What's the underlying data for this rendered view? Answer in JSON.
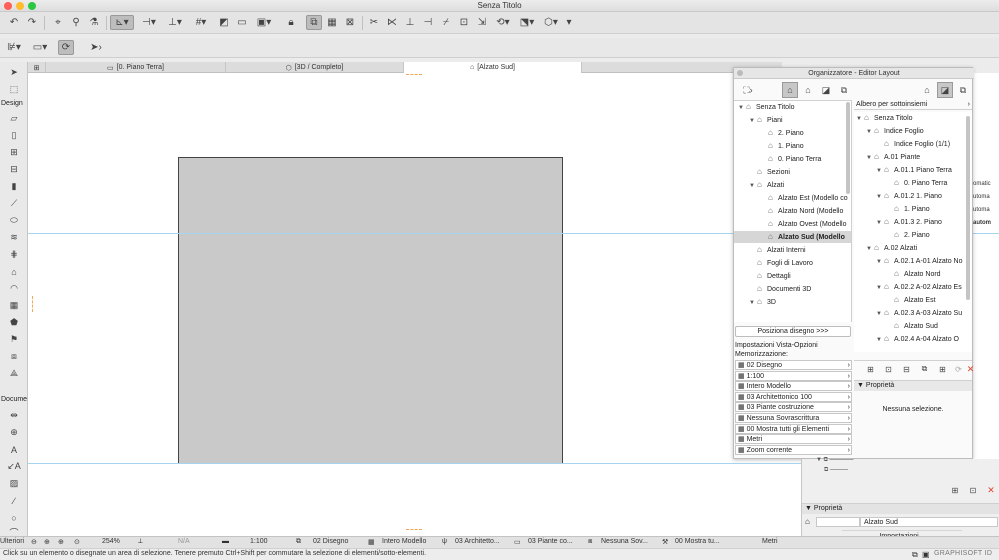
{
  "window": {
    "title": "Senza Titolo"
  },
  "toolbox": {
    "design_label": "Design",
    "document_label": "Docume",
    "more_label": "Ulteriori"
  },
  "tabs": [
    "[0. Piano Terra]",
    "[3D / Completo]",
    "[Alzato Sud]"
  ],
  "panel": {
    "title": "Organizzatore - Editor Layout",
    "left_tree": [
      {
        "label": "Senza Titolo",
        "depth": 0,
        "open": true,
        "icon": "project-icon"
      },
      {
        "label": "Piani",
        "depth": 1,
        "open": true,
        "icon": "folder-icon"
      },
      {
        "label": "2. Piano",
        "depth": 2,
        "icon": "story-icon"
      },
      {
        "label": "1. Piano",
        "depth": 2,
        "icon": "story-icon"
      },
      {
        "label": "0. Piano Terra",
        "depth": 2,
        "icon": "story-icon"
      },
      {
        "label": "Sezioni",
        "depth": 1,
        "icon": "section-icon"
      },
      {
        "label": "Alzati",
        "depth": 1,
        "open": true,
        "icon": "elevation-icon"
      },
      {
        "label": "Alzato Est (Modello co",
        "depth": 2,
        "icon": "elevation-icon"
      },
      {
        "label": "Alzato Nord (Modello",
        "depth": 2,
        "icon": "elevation-icon"
      },
      {
        "label": "Alzato Ovest (Modello",
        "depth": 2,
        "icon": "elevation-icon"
      },
      {
        "label": "Alzato Sud (Modello",
        "depth": 2,
        "icon": "elevation-icon",
        "selected": true
      },
      {
        "label": "Alzati Interni",
        "depth": 1,
        "icon": "interior-elevation-icon"
      },
      {
        "label": "Fogli di Lavoro",
        "depth": 1,
        "icon": "worksheet-icon"
      },
      {
        "label": "Dettagli",
        "depth": 1,
        "icon": "detail-icon"
      },
      {
        "label": "Documenti 3D",
        "depth": 1,
        "icon": "doc3d-icon"
      },
      {
        "label": "3D",
        "depth": 1,
        "open": true,
        "icon": "cube-icon"
      }
    ],
    "place_button": "Posiziona disegno >>>",
    "view_settings_label": "Impostazioni Vista-Opzioni Memorizzazione:",
    "view_options": [
      "02 Disegno",
      "1:100",
      "Intero Modello",
      "03 Architettonico 100",
      "03 Piante costruzione",
      "Nessuna Sovrascrittura",
      "00 Mostra tutti gli Elementi",
      "Metri",
      "Zoom corrente"
    ],
    "right_header": "Albero per sottoinsiemi",
    "right_tree": [
      {
        "label": "Senza Titolo",
        "depth": 0,
        "open": true
      },
      {
        "label": "Indice Foglio",
        "depth": 1,
        "open": true
      },
      {
        "label": "Indice Foglio (1/1)",
        "depth": 2
      },
      {
        "label": "A.01 Piante",
        "depth": 1,
        "open": true
      },
      {
        "label": "A.01.1 Piano Terra",
        "depth": 2,
        "open": true
      },
      {
        "label": "0. Piano Terra",
        "depth": 3
      },
      {
        "label": "A.01.2 1. Piano",
        "depth": 2,
        "open": true
      },
      {
        "label": "1. Piano",
        "depth": 3
      },
      {
        "label": "A.01.3 2. Piano",
        "depth": 2,
        "open": true
      },
      {
        "label": "2. Piano",
        "depth": 3
      },
      {
        "label": "A.02 Alzati",
        "depth": 1,
        "open": true
      },
      {
        "label": "A.02.1 A-01 Alzato No",
        "depth": 2,
        "open": true
      },
      {
        "label": "Alzato Nord",
        "depth": 3
      },
      {
        "label": "A.02.2 A-02 Alzato Es",
        "depth": 2,
        "open": true
      },
      {
        "label": "Alzato Est",
        "depth": 3
      },
      {
        "label": "A.02.3 A-03 Alzato Su",
        "depth": 2,
        "open": true
      },
      {
        "label": "Alzato Sud",
        "depth": 3
      },
      {
        "label": "A.02.4 A-04 Alzato O",
        "depth": 2,
        "open": true
      }
    ],
    "properties_label": "Proprietà",
    "no_selection": "Nessuna selezione.",
    "behind_fragments": [
      "omatic",
      "utoma",
      "utoma",
      "autom"
    ]
  },
  "right_lower": {
    "properties_label": "Proprietà",
    "name_value": "Alzato Sud",
    "settings_button": "Impostazioni..."
  },
  "statusbar": {
    "zoom": "254%",
    "angle": "N/A",
    "scale": "1:100",
    "layer": "02 Disegno",
    "model": "Intero Modello",
    "pen": "03 Architetto...",
    "mvo": "03 Piante co...",
    "override": "Nessuna Sov...",
    "renovation": "00 Mostra tu...",
    "units": "Metri"
  },
  "hint": "Click su un elemento o disegnate un area di selezione. Tenere premuto Ctrl+Shift per commutare la selezione di elementi/sotto-elementi.",
  "brand": "GRAPHISOFT ID",
  "colors": {
    "guide": "#a7d4ef",
    "wall_fill": "#c9c9c9",
    "close": "#ff5f57",
    "minimize": "#febc2e",
    "zoom": "#28c840"
  }
}
